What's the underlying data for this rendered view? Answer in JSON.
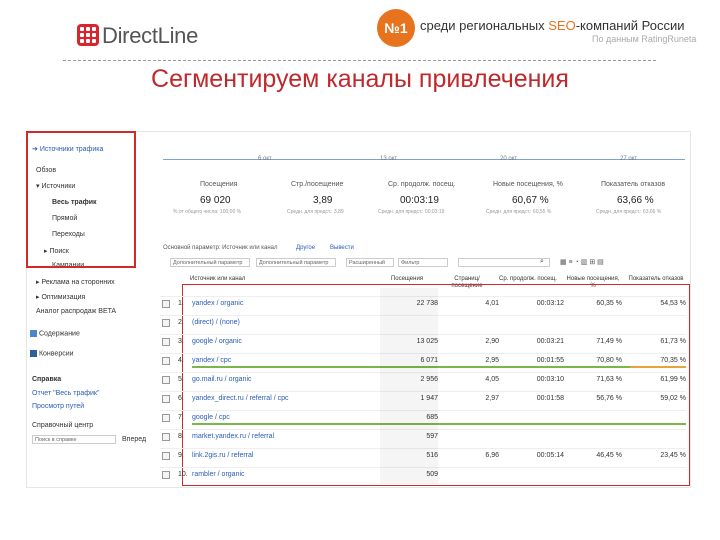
{
  "header": {
    "logo_text": "DirectLine",
    "badge": "№1",
    "tagline_prefix": "среди региональных ",
    "tagline_seo": "SEO",
    "tagline_suffix": "-компаний России",
    "subline": "По данным RatingRuneta",
    "title": "Сегментируем каналы привлечения"
  },
  "sidebar": {
    "section": "Источники трафика",
    "items": [
      "Обзов",
      "▾ Источники",
      "Весь трафик",
      "Прямой",
      "Переходы",
      "▸ Поиск",
      "Кампании",
      "▸ Реклама на сторонних",
      "▸ Оптимизация",
      "Аналог распродаж BETA"
    ],
    "content": "Содержание",
    "events": "Конверсии",
    "help_title": "Справка",
    "help_links": [
      "Отчет \"Весь трафик\"",
      "Просмотр путей"
    ],
    "search_label": "Справочный центр",
    "search_placeholder": "Поиск в справке",
    "search_button": "Вперед"
  },
  "chart": {
    "dates": [
      "6 окт",
      "13 окт",
      "20 окт",
      "27 окт"
    ],
    "stats": [
      {
        "label": "Посещения",
        "value": "69 020",
        "sub": "% от общего числа: 100,00 %"
      },
      {
        "label": "Стр./посещение",
        "value": "3,89",
        "sub": "Средн. для предст.: 3,89"
      },
      {
        "label": "Ср. продолж. посещ.",
        "value": "00:03:19",
        "sub": "Средн. для предст.: 00:03:19"
      },
      {
        "label": "Новые посещения, %",
        "value": "60,67 %",
        "sub": "Средн. для предст.: 60,55 %"
      },
      {
        "label": "Показатель отказов",
        "value": "63,66 %",
        "sub": "Средн. для предст.: 63,66 %"
      }
    ]
  },
  "toolbar": {
    "dimension_label": "Основной параметр: Источник или канал",
    "other": "Другое",
    "view_label": "Вывести",
    "second_dim": "Дополнительный параметр",
    "filter": "Расширенный",
    "filter_value": "Фильтр",
    "search": "Поиск",
    "show": "Показать строки: 10"
  },
  "table": {
    "headers": [
      "Источник или канал",
      "Посещения",
      "Страниц/посещение",
      "Ср. продолж. посещ.",
      "Новые посещения, %",
      "Показатель отказов"
    ],
    "rows": [
      {
        "n": "1.",
        "name": "yandex / organic",
        "visits": "22 738",
        "ppv": "4,01",
        "dur": "00:03:12",
        "new": "60,35 %",
        "bounce": "54,53 %"
      },
      {
        "n": "2.",
        "name": "(direct) / (none)",
        "visits": "",
        "ppv": "",
        "dur": "",
        "new": "",
        "bounce": ""
      },
      {
        "n": "3.",
        "name": "google / organic",
        "visits": "13 025",
        "ppv": "2,90",
        "dur": "00:03:21",
        "new": "71,49 %",
        "bounce": "61,73 %"
      },
      {
        "n": "4.",
        "name": "yandex / cpc",
        "visits": "6 071",
        "ppv": "2,95",
        "dur": "00:01:55",
        "new": "70,80 %",
        "bounce": "70,35 %"
      },
      {
        "n": "5.",
        "name": "go.mail.ru / organic",
        "visits": "2 956",
        "ppv": "4,05",
        "dur": "00:03:10",
        "new": "71,63 %",
        "bounce": "61,99 %"
      },
      {
        "n": "6.",
        "name": "yandex_direct.ru / referral / cpc",
        "visits": "1 947",
        "ppv": "2,97",
        "dur": "00:01:58",
        "new": "56,76 %",
        "bounce": "59,02 %"
      },
      {
        "n": "7.",
        "name": "google / cpc",
        "visits": "685",
        "ppv": "",
        "dur": "",
        "new": "",
        "bounce": ""
      },
      {
        "n": "8.",
        "name": "market.yandex.ru / referral",
        "visits": "597",
        "ppv": "",
        "dur": "",
        "new": "",
        "bounce": ""
      },
      {
        "n": "9.",
        "name": "link.2gis.ru / referral",
        "visits": "516",
        "ppv": "6,96",
        "dur": "00:05:14",
        "new": "46,45 %",
        "bounce": "23,45 %"
      },
      {
        "n": "10.",
        "name": "rambler / organic",
        "visits": "509",
        "ppv": "",
        "dur": "",
        "new": "",
        "bounce": ""
      }
    ]
  },
  "colors": {
    "brand_red": "#c0282c",
    "badge_orange": "#e8731f",
    "link_blue": "#2a5db0",
    "highlight_green": "#7ab648"
  }
}
